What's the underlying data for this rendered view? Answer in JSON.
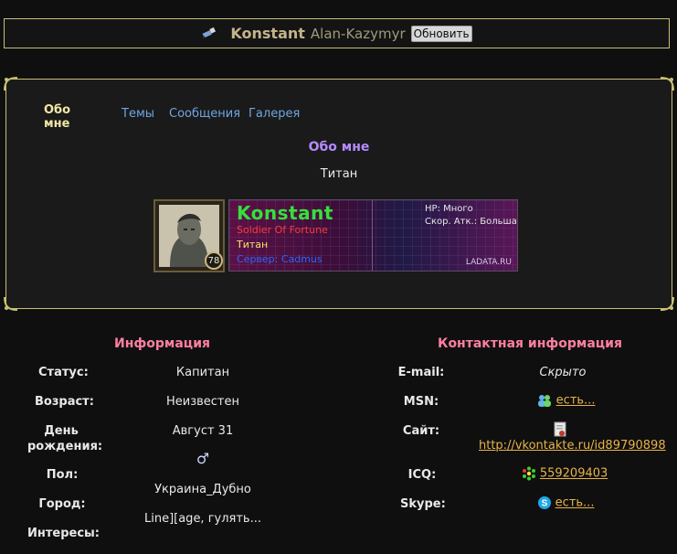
{
  "header": {
    "nickname": "Konstant",
    "realname": "Alan-Kazymyr",
    "refresh_label": "Обновить"
  },
  "tabs": [
    {
      "label": "Обо мне",
      "active": true
    },
    {
      "label": "Темы"
    },
    {
      "label": "Сообщения"
    },
    {
      "label": "Галерея"
    }
  ],
  "about": {
    "title": "Обо мне",
    "text": "Титан"
  },
  "character_card": {
    "level": "78",
    "name": "Konstant",
    "class": "Soldier Of Fortune",
    "race": "Титан",
    "server": "Сервер: Cadmus",
    "hp": "HP: Много",
    "attack_speed": "Скор. Атк.: Большая",
    "site": "LADATA.RU"
  },
  "info": {
    "title": "Информация",
    "status_label": "Статус:",
    "status_value": "Капитан",
    "age_label": "Возраст:",
    "age_value": "Неизвестен",
    "birthday_label_1": "День",
    "birthday_label_2": "рождения:",
    "birthday_value": "Август 31",
    "gender_label": "Пол:",
    "gender_symbol": "♂",
    "city_label": "Город:",
    "city_value": "Украина_Дубно",
    "interests_label": "Интересы:",
    "interests_value": "Line][age, гулять..."
  },
  "contact": {
    "title": "Контактная информация",
    "email_label": "E-mail:",
    "email_value": "Скрыто",
    "msn_label": "MSN:",
    "msn_value": "есть...",
    "site_label": "Сайт:",
    "site_value": "http://vkontakte.ru/id89790898",
    "icq_label": "ICQ:",
    "icq_value": "559209403",
    "skype_label": "Skype:",
    "skype_value": "есть..."
  },
  "colors": {
    "accent_gold": "#c9bf74",
    "link": "#e8b34a",
    "tab_link": "#6ea6e0",
    "section_title": "#ff7fa1",
    "about_title": "#b58aff"
  }
}
